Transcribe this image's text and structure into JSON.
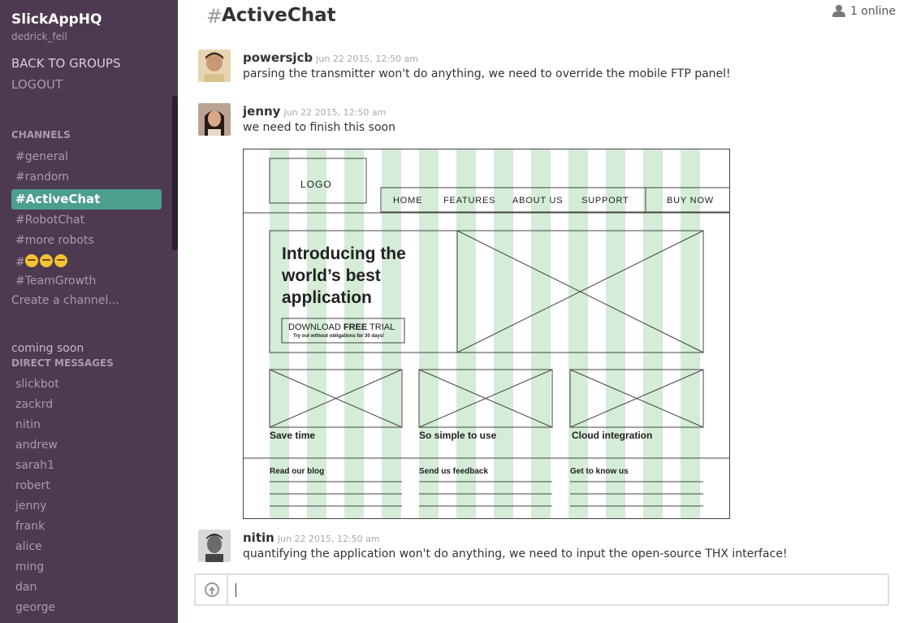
{
  "sidebar": {
    "team_name": "SlickAppHQ",
    "username": "dedrick_feil",
    "back_label": "BACK TO GROUPS",
    "logout_label": "LOGOUT",
    "channels_title": "CHANNELS",
    "channels": [
      {
        "label": "#general",
        "active": false
      },
      {
        "label": "#random",
        "active": false
      },
      {
        "label": "#ActiveChat",
        "active": true
      },
      {
        "label": "#RobotChat",
        "active": false
      },
      {
        "label": "#more robots",
        "active": false
      },
      {
        "label": "#",
        "active": false,
        "emojis": [
          "sleepy-face",
          "sleepy-face",
          "sleepy-face"
        ]
      },
      {
        "label": "#TeamGrowth",
        "active": false
      }
    ],
    "create_channel_label": "Create a channel...",
    "coming_soon_label": "coming soon",
    "direct_messages_title": "DIRECT MESSAGES",
    "direct_messages": [
      "slickbot",
      "zackrd",
      "nitin",
      "andrew",
      "sarah1",
      "robert",
      "jenny",
      "frank",
      "alice",
      "ming",
      "dan",
      "george"
    ]
  },
  "header": {
    "hash": "#",
    "title": "ActiveChat",
    "online_label": "1 online",
    "online_icon": "users-icon"
  },
  "messages": [
    {
      "author": "powersjcb",
      "time": "Jun 22 2015, 12:50 am",
      "text": "parsing the transmitter won't do anything, we need to override the mobile FTP panel!"
    },
    {
      "author": "jenny",
      "time": "Jun 22 2015, 12:50 am",
      "text": "we need to finish this soon"
    },
    {
      "author": "nitin",
      "time": "Jun 22 2015, 12:50 am",
      "text": "quantifying the application won't do anything, we need to input the open-source THX interface!"
    }
  ],
  "wireframe": {
    "logo": "LOGO",
    "nav": [
      "HOME",
      "FEATURES",
      "ABOUT US",
      "SUPPORT",
      "BUY NOW"
    ],
    "hero_line1": "Introducing the",
    "hero_line2": "world’s best",
    "hero_line3": "application",
    "cta_prefix": "DOWNLOAD ",
    "cta_bold": "FREE",
    "cta_suffix": " TRIAL",
    "cta_sub": "Try out without obligations for 30 days!",
    "features": [
      "Save time",
      "So simple to use",
      "Cloud integration"
    ],
    "footer_links": [
      "Read our blog",
      "Send us feedback",
      "Get to know us"
    ]
  },
  "composer": {
    "placeholder": "",
    "value": ""
  },
  "colors": {
    "sidebar_bg": "#4d3a50",
    "active_channel": "#4c9e8f",
    "grid_column": "#d4ecd8"
  }
}
